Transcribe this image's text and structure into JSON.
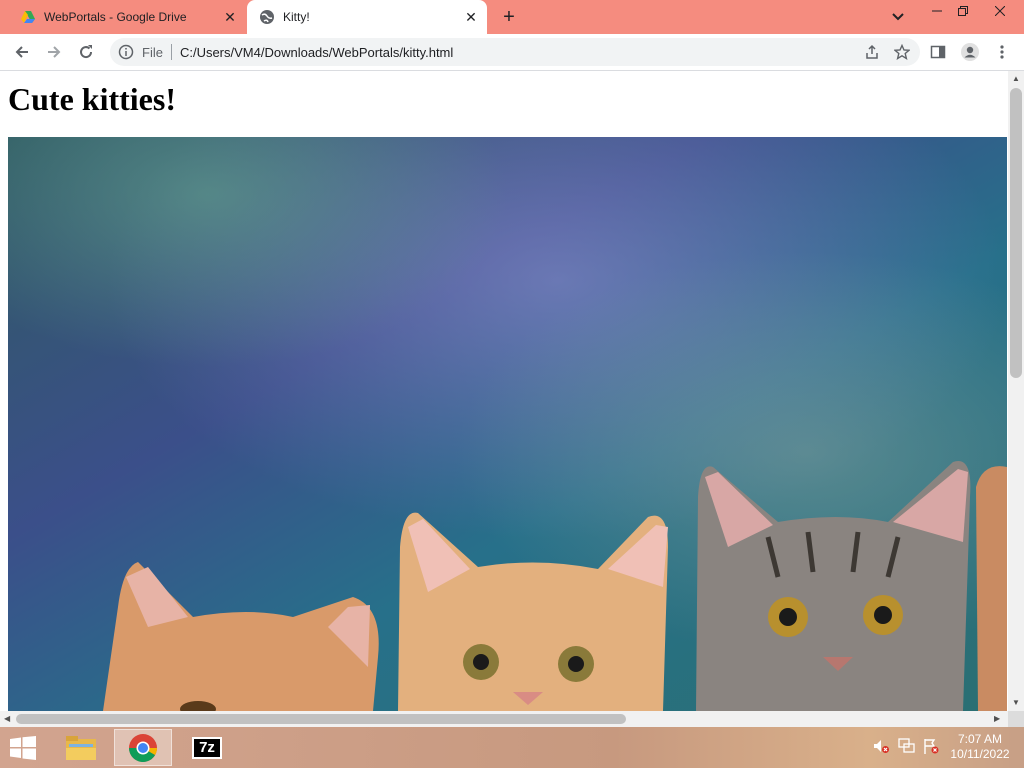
{
  "browser": {
    "tabs": [
      {
        "title": "WebPortals - Google Drive",
        "favicon": "google-drive-icon",
        "active": false
      },
      {
        "title": "Kitty!",
        "favicon": "globe-icon",
        "active": true
      }
    ],
    "address": {
      "scheme_label": "File",
      "url": "C:/Users/VM4/Downloads/WebPortals/kitty.html"
    }
  },
  "page": {
    "heading": "Cute kitties!",
    "image": {
      "alt": "kittens-photo",
      "description_icon": "kittens-image"
    }
  },
  "taskbar": {
    "apps": [
      {
        "name": "start-button"
      },
      {
        "name": "file-explorer"
      },
      {
        "name": "chrome",
        "active": true
      },
      {
        "name": "7zip",
        "label": "7z"
      }
    ],
    "clock": {
      "time": "7:07 AM",
      "date": "10/11/2022"
    }
  },
  "colors": {
    "tabstrip": "#f58c7f",
    "accent": "#1a73e8"
  }
}
